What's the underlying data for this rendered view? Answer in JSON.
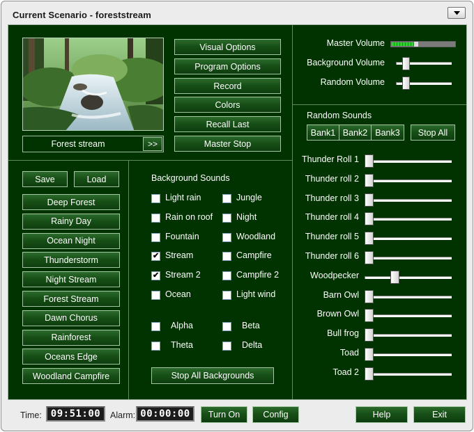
{
  "window": {
    "title": "Current Scenario - foreststream"
  },
  "scene": {
    "name": "Forest stream",
    "next_label": ">>"
  },
  "options": [
    "Visual Options",
    "Program Options",
    "Record",
    "Colors",
    "Recall Last",
    "Master Stop"
  ],
  "volumes": {
    "master_label": "Master Volume",
    "master_level": 0.42,
    "background_label": "Background Volume",
    "background_level": 0.13,
    "random_label": "Random Volume",
    "random_level": 0.13
  },
  "scenarios": {
    "save_label": "Save",
    "load_label": "Load",
    "items": [
      "Deep Forest",
      "Rainy Day",
      "Ocean Night",
      "Thunderstorm",
      "Night Stream",
      "Forest Stream",
      "Dawn Chorus",
      "Rainforest",
      "Oceans Edge",
      "Woodland Campfire"
    ]
  },
  "background": {
    "heading": "Background Sounds",
    "left": [
      {
        "label": "Light rain",
        "checked": false
      },
      {
        "label": "Rain on roof",
        "checked": false
      },
      {
        "label": "Fountain",
        "checked": false
      },
      {
        "label": "Stream",
        "checked": true
      },
      {
        "label": "Stream 2",
        "checked": true
      },
      {
        "label": "Ocean",
        "checked": false
      }
    ],
    "right": [
      {
        "label": "Jungle",
        "checked": false
      },
      {
        "label": "Night",
        "checked": false
      },
      {
        "label": "Woodland",
        "checked": false
      },
      {
        "label": "Campfire",
        "checked": false
      },
      {
        "label": "Campfire 2",
        "checked": false
      },
      {
        "label": "Light wind",
        "checked": false
      }
    ],
    "waves": [
      {
        "label": "Alpha",
        "checked": false
      },
      {
        "label": "Beta",
        "checked": false
      },
      {
        "label": "Theta",
        "checked": false
      },
      {
        "label": "Delta",
        "checked": false
      }
    ],
    "stop_all_label": "Stop All Backgrounds"
  },
  "random": {
    "heading": "Random Sounds",
    "banks": [
      "Bank1",
      "Bank2",
      "Bank3"
    ],
    "stop_all_label": "Stop All",
    "sounds": [
      {
        "label": "Thunder Roll 1",
        "level": 0.0
      },
      {
        "label": "Thunder roll 2",
        "level": 0.0
      },
      {
        "label": "Thunder roll 3",
        "level": 0.0
      },
      {
        "label": "Thunder roll 4",
        "level": 0.0
      },
      {
        "label": "Thunder roll 5",
        "level": 0.0
      },
      {
        "label": "Thunder roll 6",
        "level": 0.0
      },
      {
        "label": "Woodpecker",
        "level": 0.33
      },
      {
        "label": "Barn Owl",
        "level": 0.0
      },
      {
        "label": "Brown Owl",
        "level": 0.0
      },
      {
        "label": "Bull frog",
        "level": 0.0
      },
      {
        "label": "Toad",
        "level": 0.0
      },
      {
        "label": "Toad 2",
        "level": 0.0
      }
    ]
  },
  "footer": {
    "time_label": "Time:",
    "time_value": "09:51:00",
    "alarm_label": "Alarm:",
    "alarm_value": "00:00:00",
    "turn_on_label": "Turn On",
    "config_label": "Config",
    "help_label": "Help",
    "exit_label": "Exit"
  }
}
